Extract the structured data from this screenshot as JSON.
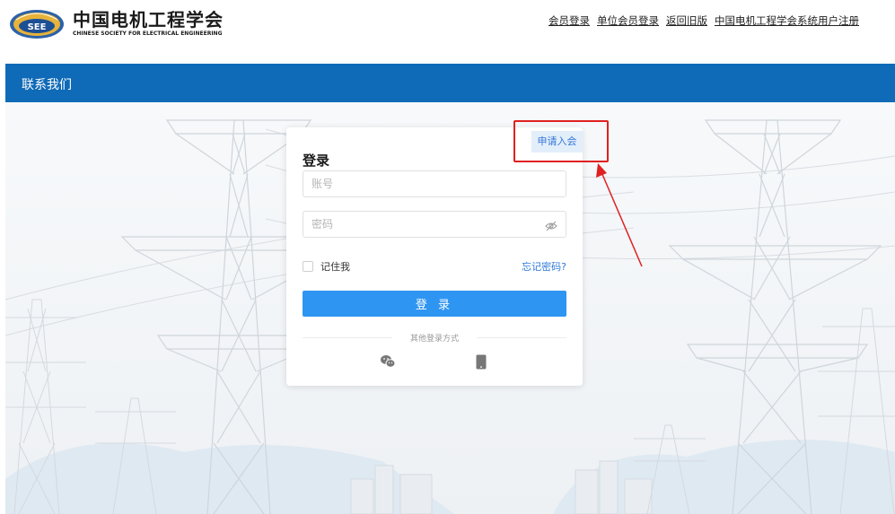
{
  "header": {
    "logo_cn": "中国电机工程学会",
    "logo_en": "CHINESE SOCIETY FOR ELECTRICAL ENGINEERING",
    "logo_badge": "SEE",
    "links": [
      "会员登录",
      "单位会员登录",
      "返回旧版",
      "中国电机工程学会系统用户注册"
    ]
  },
  "nav": {
    "contact": "联系我们"
  },
  "login": {
    "apply_label": "申请入会",
    "title": "登录",
    "account_placeholder": "账号",
    "password_placeholder": "密码",
    "remember_label": "记住我",
    "forgot_label": "忘记密码?",
    "submit_label": "登 录",
    "other_methods": "其他登录方式"
  },
  "colors": {
    "nav_bar": "#0f6ab7",
    "login_button": "#2f95f2",
    "link_blue": "#2f7ad9",
    "annotation_red": "#e02020"
  },
  "icons": [
    "eye-slash-icon",
    "wechat-icon",
    "mobile-phone-icon"
  ]
}
